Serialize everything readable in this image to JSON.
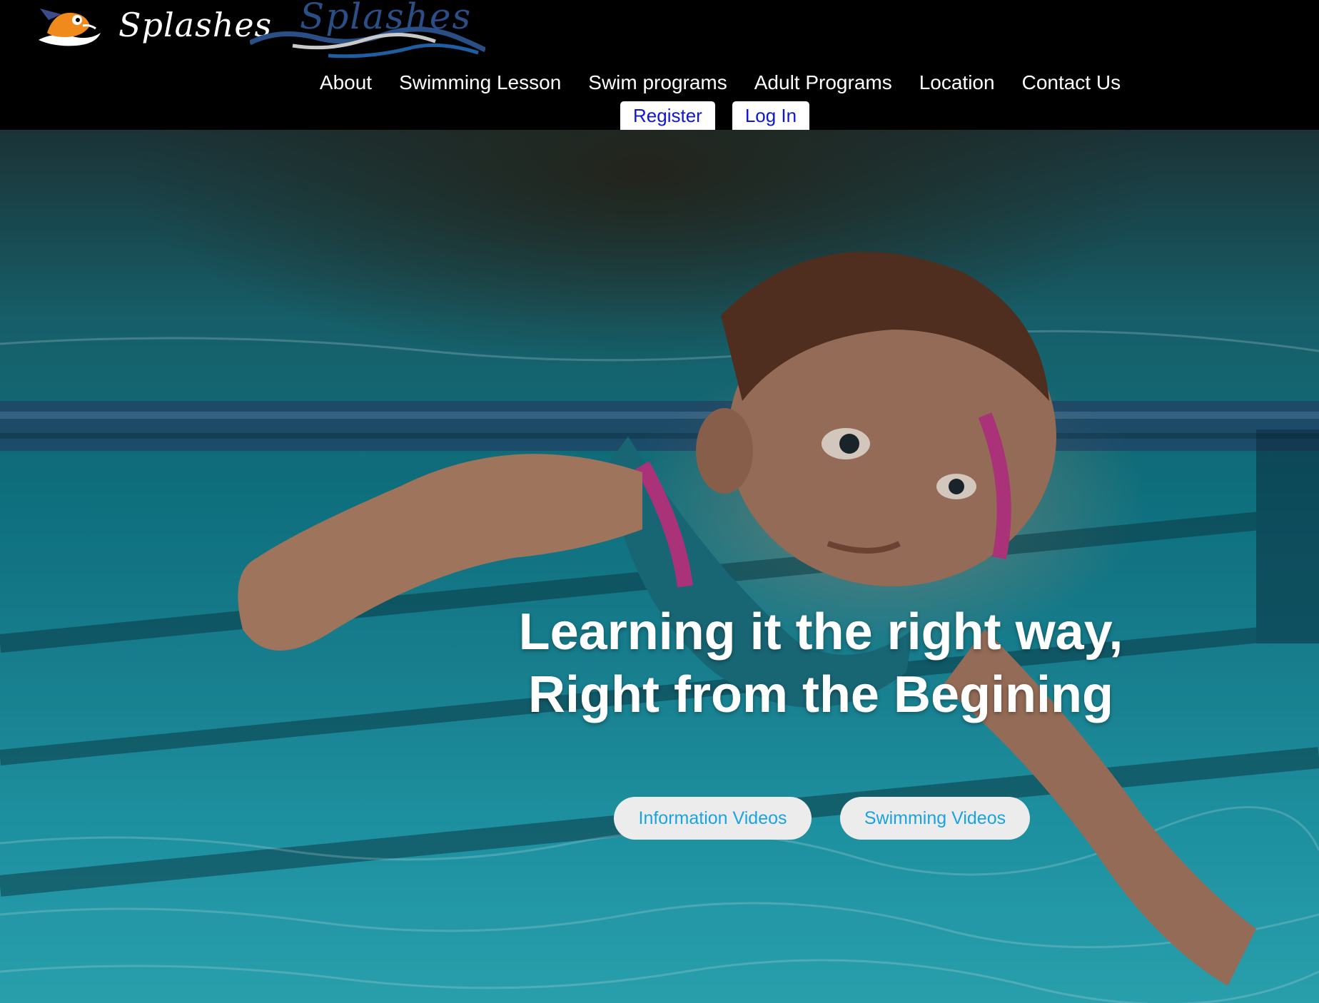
{
  "brand": {
    "name": "Splashes",
    "wordmark": "Splashes",
    "colors": {
      "header_bg": "#000000",
      "auth_text": "#0f16d6",
      "cta_text": "#1aa3e0",
      "cta_bg": "#ececec",
      "water": "#1b8ea0"
    }
  },
  "nav": {
    "items": [
      {
        "label": "About"
      },
      {
        "label": "Swimming Lesson"
      },
      {
        "label": "Swim programs"
      },
      {
        "label": "Adult Programs"
      },
      {
        "label": "Location"
      },
      {
        "label": "Contact Us"
      }
    ],
    "register_label": "Register",
    "login_label": "Log In"
  },
  "hero": {
    "headline_line1": "Learning it the right way,",
    "headline_line2": "Right from the Begining",
    "cta_info_label": "Information Videos",
    "cta_swim_label": "Swimming Videos",
    "image_subject": "baby-swimming-underwater-photo"
  },
  "icons": [
    "mascot-logo-icon",
    "wave-logo-icon"
  ]
}
